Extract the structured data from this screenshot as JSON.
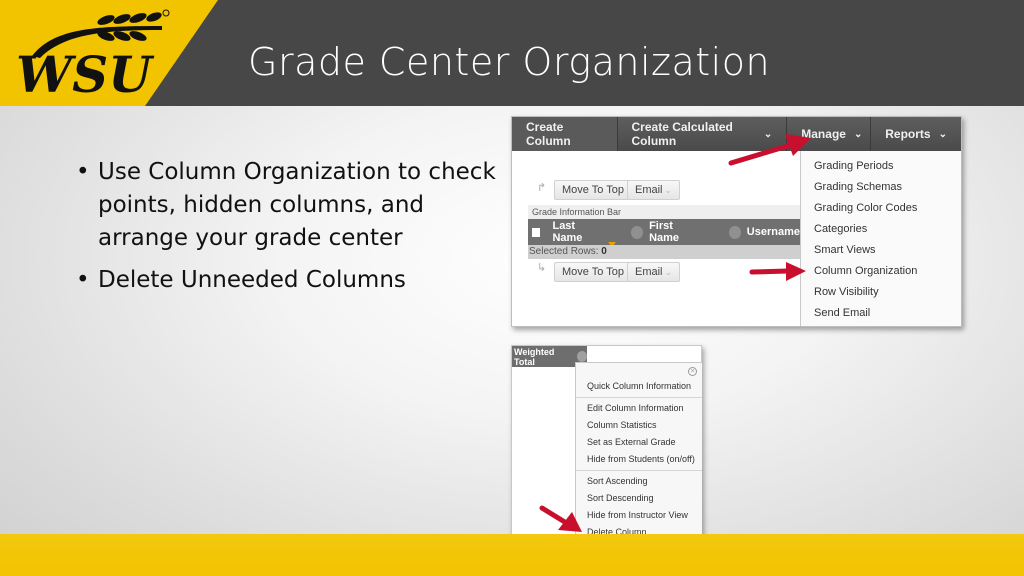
{
  "slide": {
    "title": "Grade Center Organization",
    "logo_text": "WSU",
    "bullets": [
      "Use Column Organization to check points, hidden columns, and arrange your grade center",
      "Delete Unneeded Columns"
    ],
    "colors": {
      "header_bg": "#474748",
      "brand_yellow": "#f2c400",
      "arrow_red": "#c8102e"
    }
  },
  "grade_center": {
    "action_bar": {
      "create_column": "Create Column",
      "create_calculated_column": "Create Calculated Column",
      "manage": "Manage",
      "reports": "Reports"
    },
    "toolbar_top": {
      "move_to_top": "Move To Top",
      "email": "Email"
    },
    "grade_information_bar": "Grade Information Bar",
    "columns": [
      "Last Name",
      "First Name",
      "Username"
    ],
    "selected_rows_label": "Selected Rows:",
    "selected_rows_count": "0",
    "toolbar_bottom": {
      "move_to_top": "Move To Top",
      "email": "Email"
    },
    "manage_menu": [
      "Grading Periods",
      "Grading Schemas",
      "Grading Color Codes",
      "Categories",
      "Smart Views",
      "Column Organization",
      "Row Visibility",
      "Send Email"
    ]
  },
  "column_menu": {
    "column_header": "Weighted Total",
    "items": [
      "Quick Column Information",
      "Edit Column Information",
      "Column Statistics",
      "Set as External Grade",
      "Hide from Students (on/off)",
      "Sort Ascending",
      "Sort Descending",
      "Hide from Instructor View",
      "Delete Column"
    ]
  }
}
